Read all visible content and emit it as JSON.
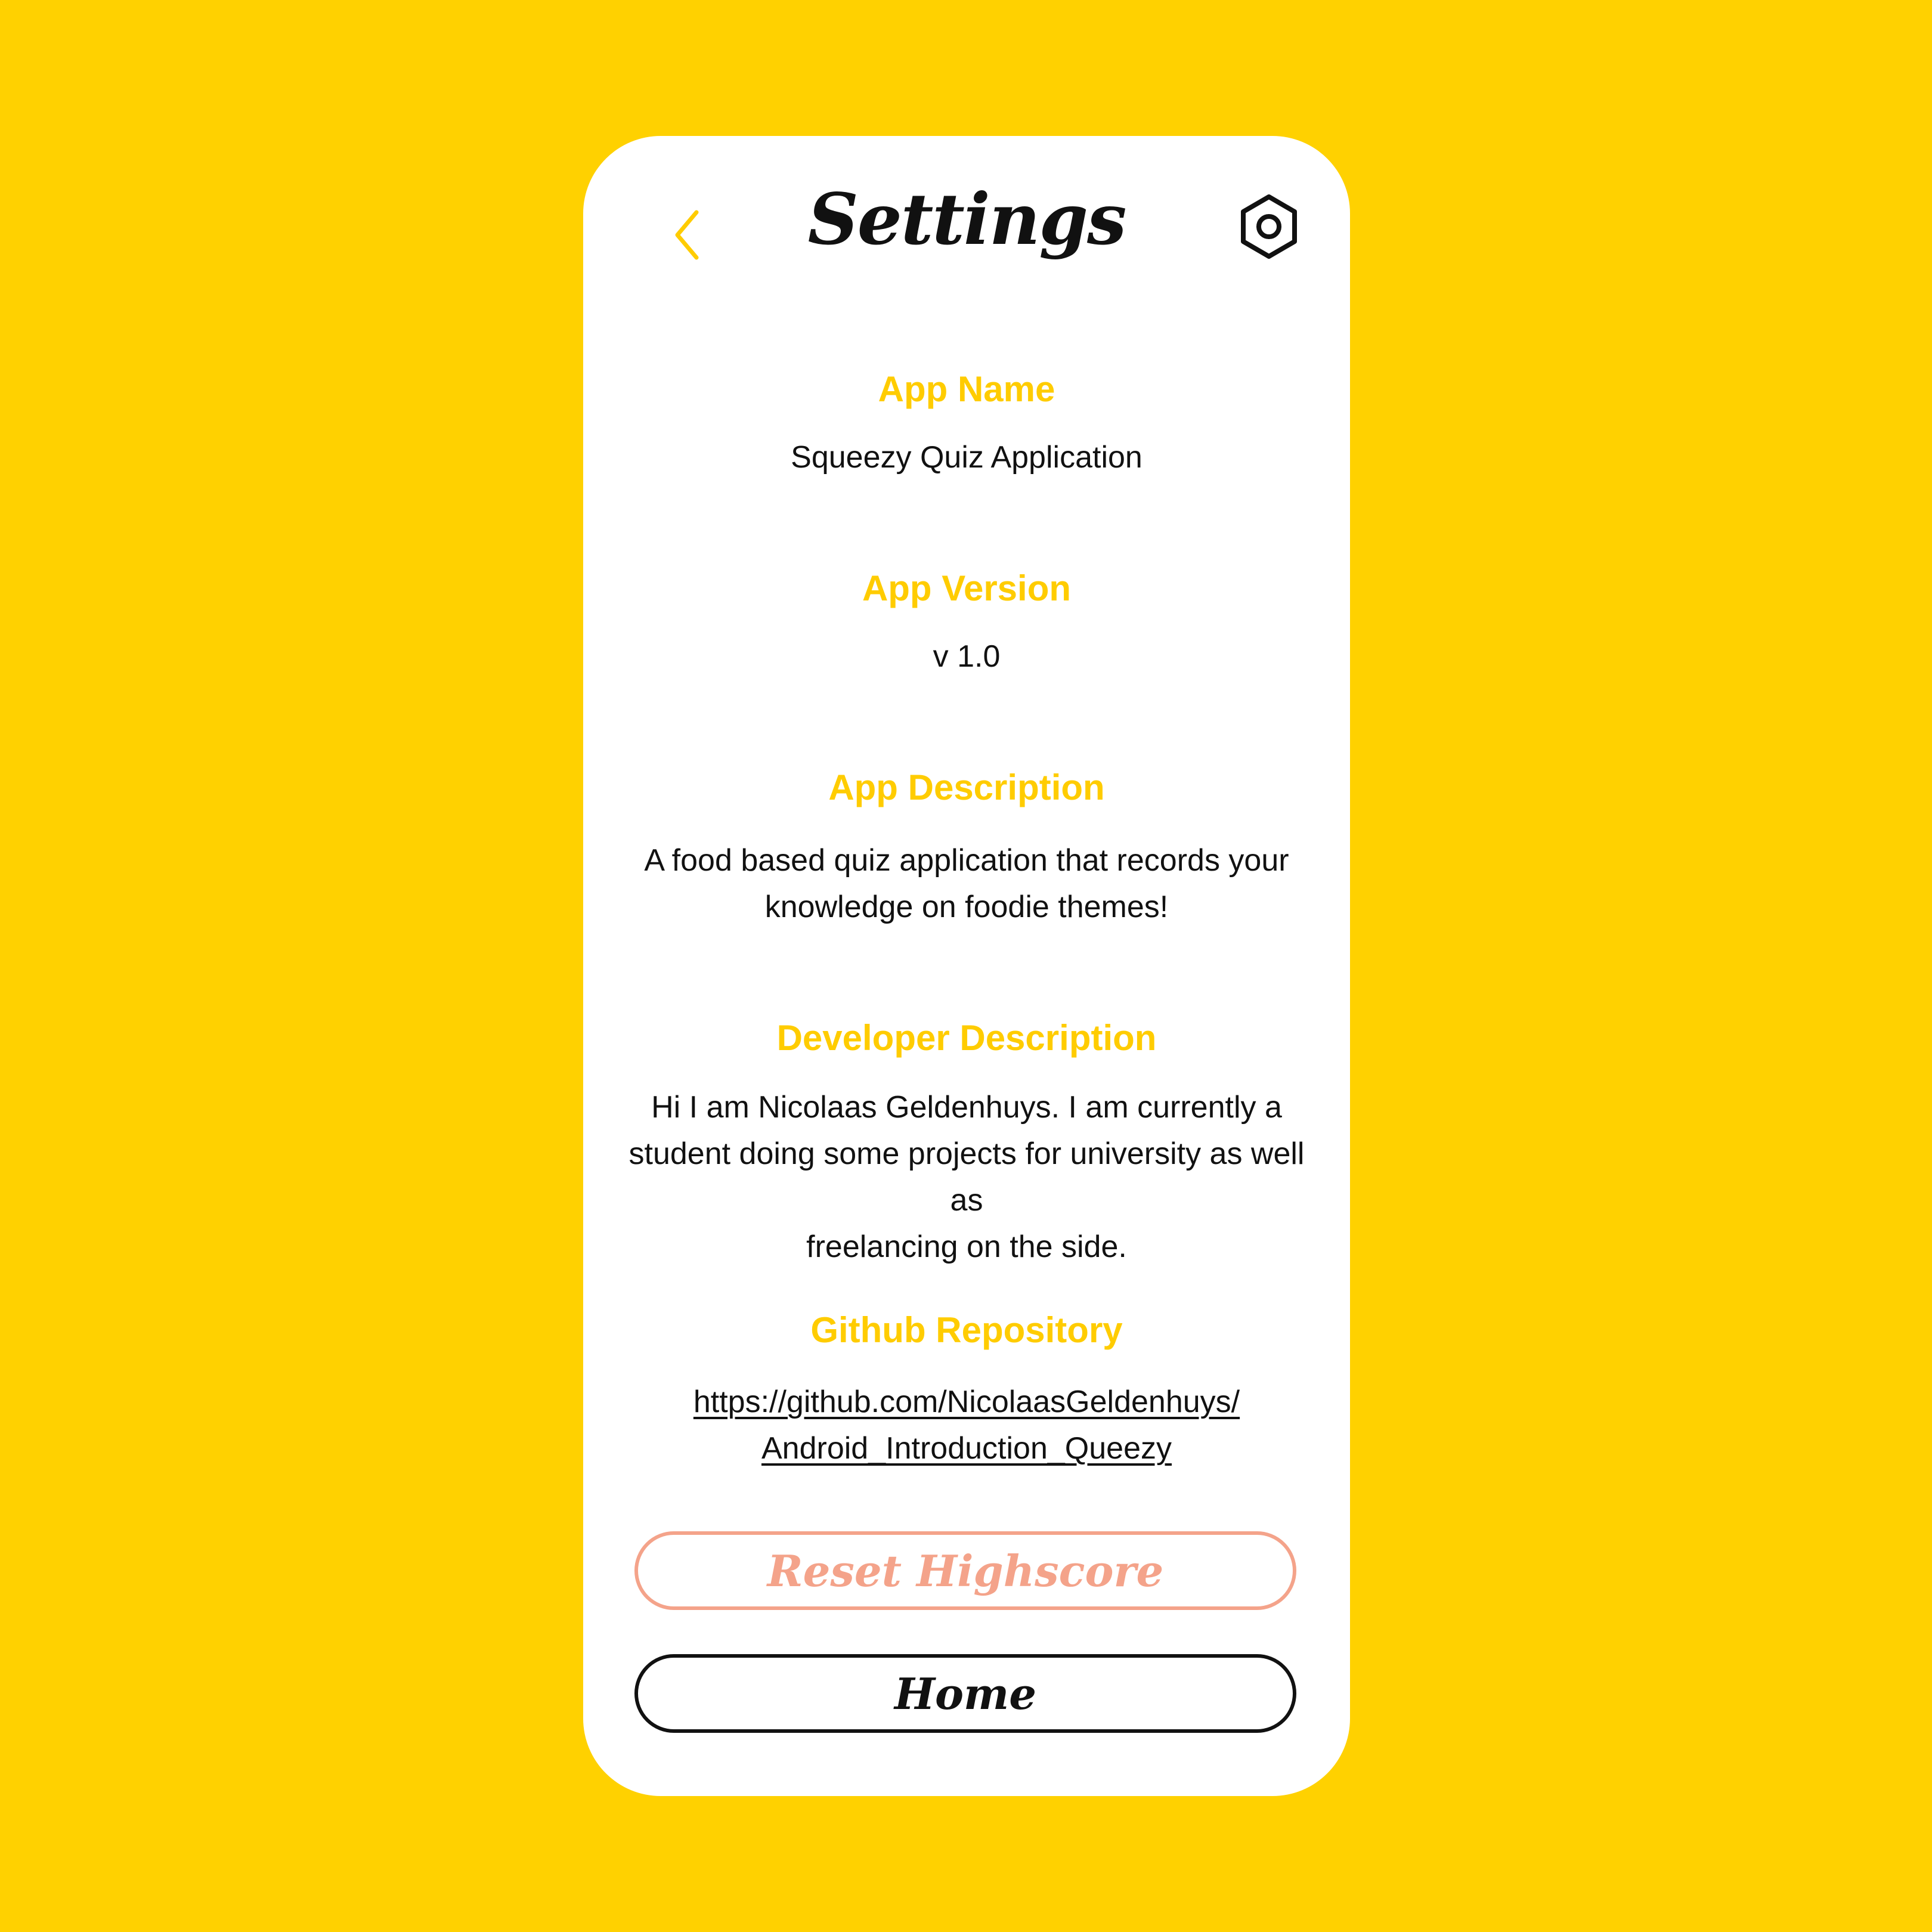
{
  "colors": {
    "background": "#FFD100",
    "card": "#FFFFFF",
    "accent": "#FFCC00",
    "text": "#111111",
    "reset_button": "#F4A38A"
  },
  "header": {
    "back_icon": "chevron-left-icon",
    "title": "Settings",
    "settings_icon": "settings-hex-icon"
  },
  "sections": [
    {
      "label": "App Name",
      "value": "Squeezy Quiz Application"
    },
    {
      "label": "App Version",
      "value": "v 1.0"
    },
    {
      "label": "App Description",
      "value": "A food based quiz application that records your",
      "value_line2": "knowledge on foodie themes!"
    },
    {
      "label": "Developer Description",
      "value": "Hi I am Nicolaas Geldenhuys. I am currently a",
      "value_line2": "student doing some projects for university as well as",
      "value_line3": "freelancing on the side."
    },
    {
      "label": "Github Repository",
      "value": "https://github.com/NicolaasGeldenhuys/",
      "value_line2": "Android_Introduction_Queezy"
    }
  ],
  "buttons": {
    "reset_label": "Reset Highscore",
    "home_label": "Home"
  }
}
